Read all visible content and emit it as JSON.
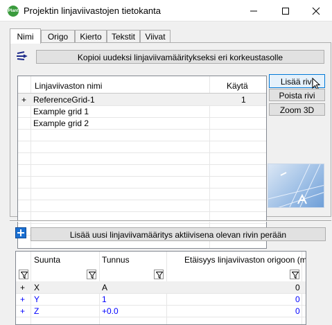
{
  "window": {
    "title": "Projektin linjaviivastojen tietokanta",
    "app_icon_text": "Plant"
  },
  "tabs": [
    {
      "label": "Nimi",
      "active": true
    },
    {
      "label": "Origo",
      "active": false
    },
    {
      "label": "Kierto",
      "active": false
    },
    {
      "label": "Tekstit",
      "active": false
    },
    {
      "label": "Viivat",
      "active": false
    }
  ],
  "copy_button_label": "Kopioi uudeksi linjaviivamääritykseksi eri korkeustasolle",
  "grid": {
    "col_name": "Linjaviivaston nimi",
    "col_use": "Käytä",
    "rows": [
      {
        "marker": "+",
        "name": "ReferenceGrid-1",
        "use": "1"
      },
      {
        "marker": "",
        "name": "Example grid 1",
        "use": ""
      },
      {
        "marker": "",
        "name": "Example grid 2",
        "use": ""
      }
    ]
  },
  "side_buttons": {
    "add_row": "Lisää rivi",
    "remove_row": "Poista rivi",
    "zoom3d": "Zoom 3D"
  },
  "add_definition_button_label": "Lisää uusi linjaviivamääritys aktiivisena olevan rivin perään",
  "axes_grid": {
    "col_direction": "Suunta",
    "col_id": "Tunnus",
    "col_distance": "Etäisyys linjaviivaston origoon (mm)",
    "rows": [
      {
        "marker": "+",
        "direction": "X",
        "id": "A",
        "distance": "0",
        "blue": false
      },
      {
        "marker": "+",
        "direction": "Y",
        "id": "1",
        "distance": "0",
        "blue": true
      },
      {
        "marker": "+",
        "direction": "Z",
        "id": "+0.0",
        "distance": "0",
        "blue": true
      }
    ]
  },
  "colors": {
    "accent": "#0078d7",
    "app_icon": "#3a9b3d",
    "link_blue": "#0000ff"
  }
}
